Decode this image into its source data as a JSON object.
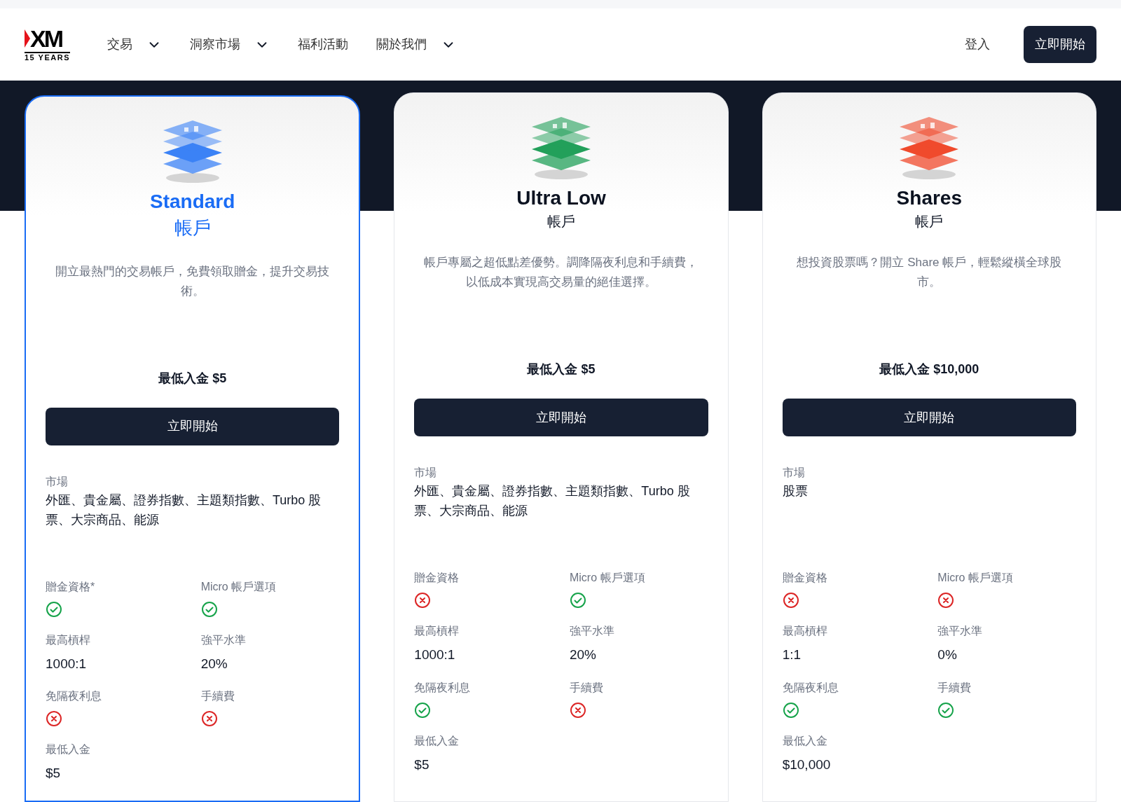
{
  "logo": {
    "text": "XM",
    "tagline": "15 YEARS"
  },
  "nav": [
    {
      "label": "交易",
      "dropdown": true
    },
    {
      "label": "洞察市場",
      "dropdown": true
    },
    {
      "label": "福利活動",
      "dropdown": false
    },
    {
      "label": "關於我們",
      "dropdown": true
    }
  ],
  "login": "登入",
  "cta": "立即開始",
  "cards": [
    {
      "name": "Standard",
      "subtitle": "帳戶",
      "selected": true,
      "color": "#3b82f6",
      "description": "開立最熱門的交易帳戶，免費領取贈金，提升交易技術。",
      "min_deposit": "最低入金 $5",
      "button": "立即開始",
      "markets_label": "市場",
      "markets": "外匯、貴金屬、證券指數、主題類指數、Turbo 股票、大宗商品、能源",
      "features": [
        {
          "label": "贈金資格*",
          "kind": "bool",
          "available": true
        },
        {
          "label": "Micro 帳戶選項",
          "kind": "bool",
          "available": true
        },
        {
          "label": "最高槓桿",
          "kind": "text",
          "value": "1000:1"
        },
        {
          "label": "強平水準",
          "kind": "text",
          "value": "20%"
        },
        {
          "label": "免隔夜利息",
          "kind": "bool",
          "available": false
        },
        {
          "label": "手續費",
          "kind": "bool",
          "available": false
        },
        {
          "label": "最低入金",
          "kind": "text",
          "value": "$5"
        }
      ]
    },
    {
      "name": "Ultra Low",
      "subtitle": "帳戶",
      "selected": false,
      "color": "#22a05a",
      "description": "帳戶專屬之超低點差優勢。調降隔夜利息和手續費，以低成本實現高交易量的絕佳選擇。",
      "min_deposit": "最低入金 $5",
      "button": "立即開始",
      "markets_label": "市場",
      "markets": "外匯、貴金屬、證券指數、主題類指數、Turbo 股票、大宗商品、能源",
      "features": [
        {
          "label": "贈金資格",
          "kind": "bool",
          "available": false
        },
        {
          "label": "Micro 帳戶選項",
          "kind": "bool",
          "available": true
        },
        {
          "label": "最高槓桿",
          "kind": "text",
          "value": "1000:1"
        },
        {
          "label": "強平水準",
          "kind": "text",
          "value": "20%"
        },
        {
          "label": "免隔夜利息",
          "kind": "bool",
          "available": true
        },
        {
          "label": "手續費",
          "kind": "bool",
          "available": false
        },
        {
          "label": "最低入金",
          "kind": "text",
          "value": "$5"
        }
      ]
    },
    {
      "name": "Shares",
      "subtitle": "帳戶",
      "selected": false,
      "color": "#f04a2c",
      "description": "想投資股票嗎？開立 Share 帳戶，輕鬆縱橫全球股市。",
      "min_deposit": "最低入金 $10,000",
      "button": "立即開始",
      "markets_label": "市場",
      "markets": "股票",
      "features": [
        {
          "label": "贈金資格",
          "kind": "bool",
          "available": false
        },
        {
          "label": "Micro 帳戶選項",
          "kind": "bool",
          "available": false
        },
        {
          "label": "最高槓桿",
          "kind": "text",
          "value": "1:1"
        },
        {
          "label": "強平水準",
          "kind": "text",
          "value": "0%"
        },
        {
          "label": "免隔夜利息",
          "kind": "bool",
          "available": true
        },
        {
          "label": "手續費",
          "kind": "bool",
          "available": true
        },
        {
          "label": "最低入金",
          "kind": "text",
          "value": "$10,000"
        }
      ]
    }
  ]
}
